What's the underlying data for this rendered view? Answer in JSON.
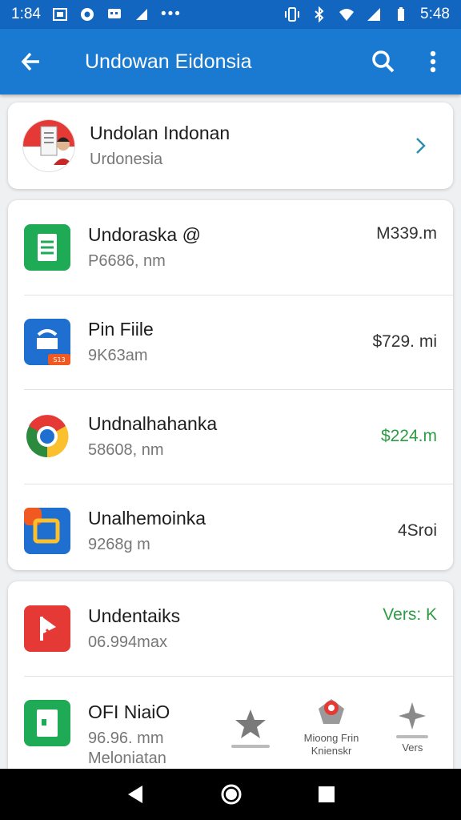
{
  "status_bar": {
    "time": "1:84",
    "battery_text": "5:48"
  },
  "app_bar": {
    "title": "Undowan Eidonsia"
  },
  "profile": {
    "name": "Undolan Indonan",
    "subtitle": "Urdonesia"
  },
  "list_a": [
    {
      "title": "Undoraska @",
      "subtitle": "P6686, nm",
      "value": "M339.m",
      "value_color": "#333333",
      "icon": "document-icon",
      "icon_color": "#1faa55"
    },
    {
      "title": "Pin Fiile",
      "subtitle": "9K63am",
      "value": "$729. mi",
      "value_color": "#333333",
      "icon": "lock-file-icon",
      "icon_color": "#1f6fd0"
    },
    {
      "title": "Undnalhahanka",
      "subtitle": "58608, nm",
      "value": "$224.m",
      "value_color": "#2e9c45",
      "icon": "chrome-icon",
      "icon_color": "#e53935"
    },
    {
      "title": "Unalhemoinka",
      "subtitle": "9268g m",
      "value": "4Sroi",
      "value_color": "#333333",
      "icon": "folder-icon",
      "icon_color": "#1f6fd0"
    }
  ],
  "list_b": [
    {
      "title": "Undentaiks",
      "subtitle": "06.994max",
      "value": "Vers: K",
      "value_color": "#2e9c45",
      "icon": "play-flag-icon",
      "icon_color": "#e53935"
    },
    {
      "title": "OFI NiaiO",
      "subtitle": "96.96. mm",
      "subtitle2": "Meloniatan",
      "icon": "gallery-icon",
      "icon_color": "#1faa55"
    }
  ],
  "bottom_tabs": [
    {
      "label": "",
      "icon": "star-icon"
    },
    {
      "label": "Mioong Frin\nKnienskr",
      "icon": "badge-icon"
    },
    {
      "label": "Vers",
      "icon": "sparkle-icon"
    }
  ]
}
